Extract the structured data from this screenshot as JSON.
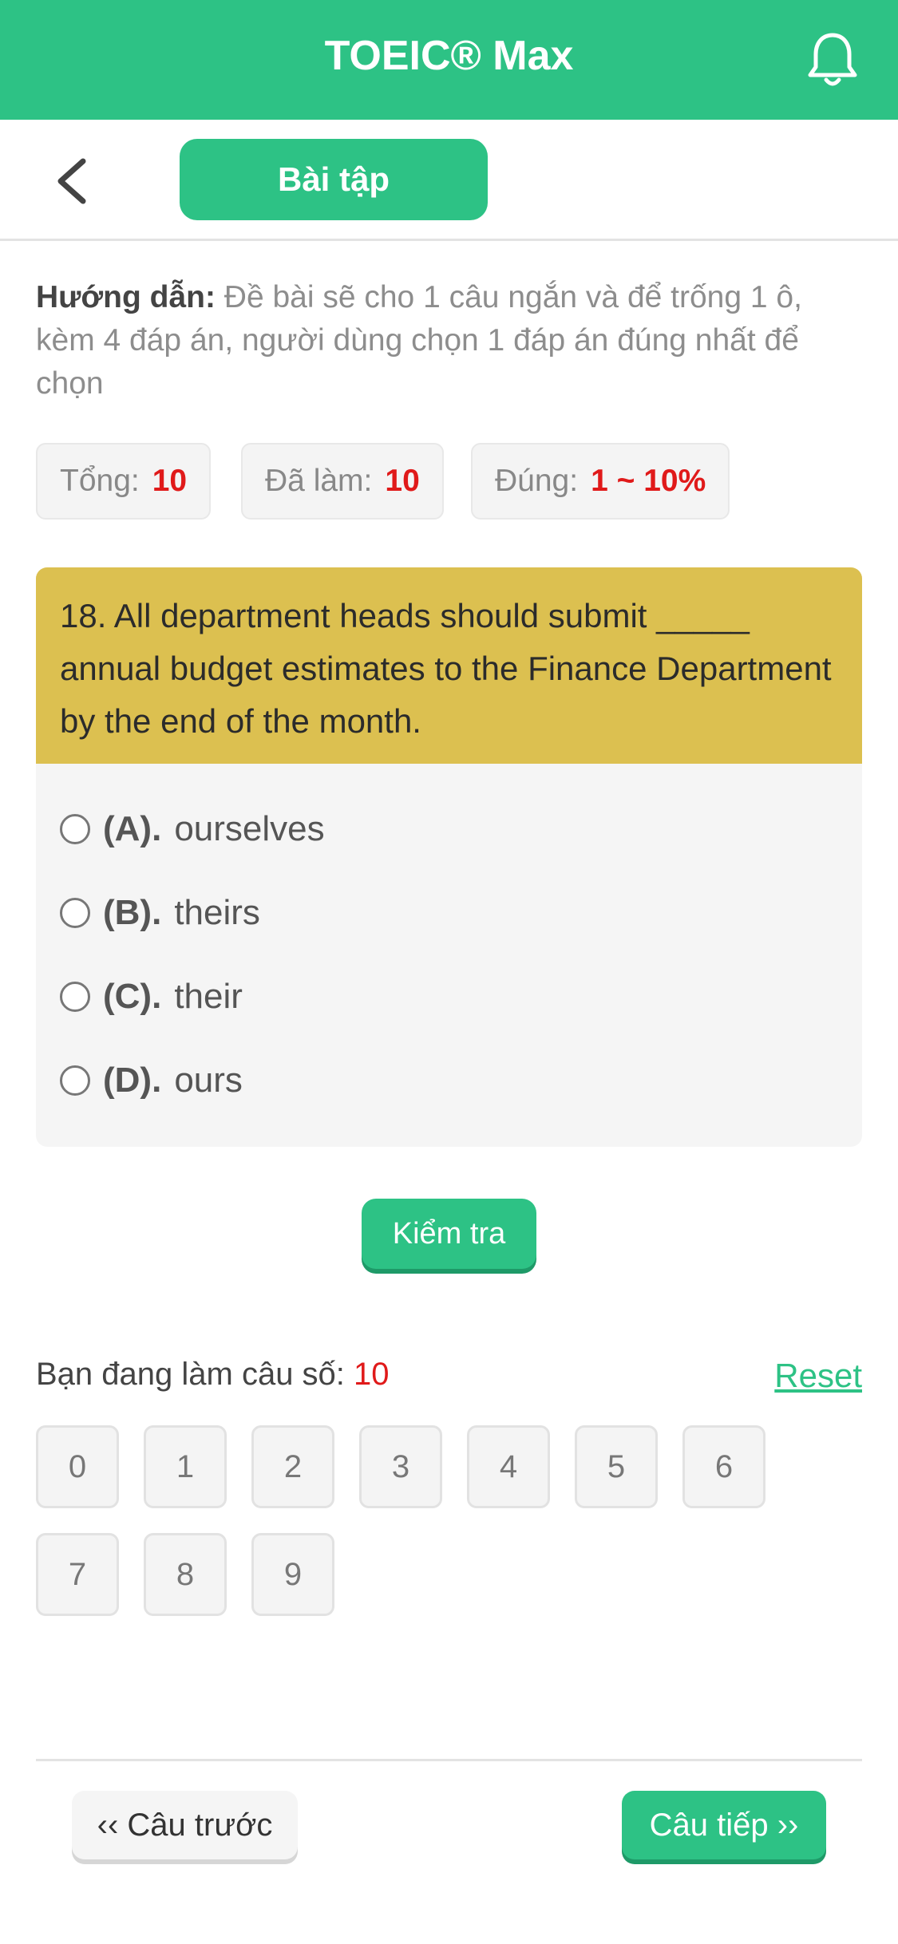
{
  "header": {
    "title": "TOEIC® Max"
  },
  "subbar": {
    "tab_label": "Bài tập"
  },
  "instruction": {
    "label": "Hướng dẫn:",
    "text": " Đề bài sẽ cho 1 câu ngắn và để trống 1 ô, kèm 4 đáp án, người dùng chọn 1 đáp án đúng nhất để chọn"
  },
  "stats": {
    "total_label": "Tổng:",
    "total_value": "10",
    "done_label": "Đã làm:",
    "done_value": "10",
    "correct_label": "Đúng:",
    "correct_value": "1 ~ 10%"
  },
  "question": {
    "text": "18. All department heads should submit _____ annual budget estimates to the Finance Department by the end of the month.",
    "options": [
      {
        "key": "(A).",
        "text": "ourselves"
      },
      {
        "key": "(B).",
        "text": "theirs"
      },
      {
        "key": "(C).",
        "text": "their"
      },
      {
        "key": "(D).",
        "text": "ours"
      }
    ]
  },
  "check_button": "Kiểm tra",
  "progress": {
    "label": "Bạn đang làm câu số:",
    "current": "10",
    "reset_label": "Reset"
  },
  "question_numbers": [
    "0",
    "1",
    "2",
    "3",
    "4",
    "5",
    "6",
    "7",
    "8",
    "9"
  ],
  "footer": {
    "prev_label": "‹‹ Câu trước",
    "next_label": "Câu tiếp ››"
  },
  "colors": {
    "primary": "#2dc285",
    "question_bg": "#dcc050",
    "highlight": "#e01a1a"
  }
}
